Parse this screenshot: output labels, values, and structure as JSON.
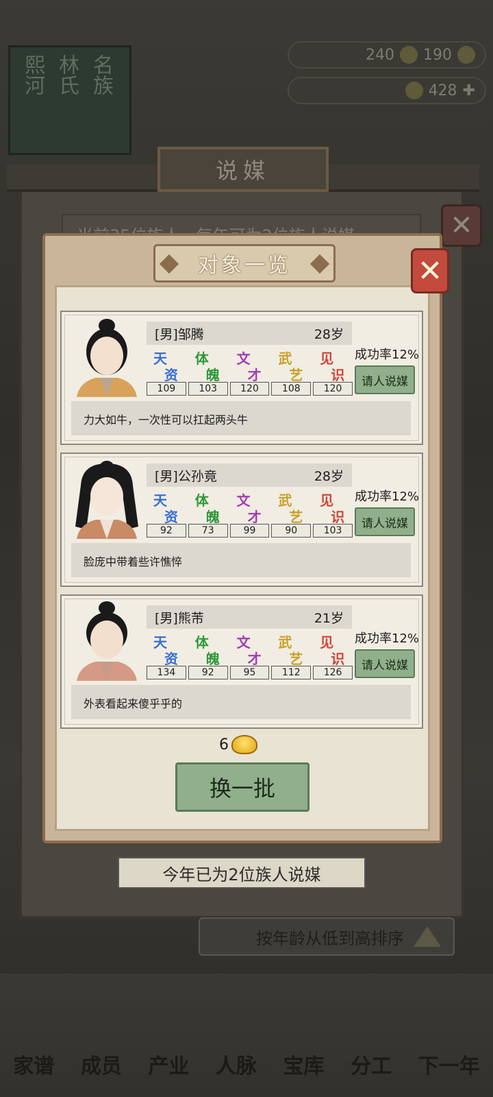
{
  "background": {
    "clan_banner": [
      "熙河",
      "林氏",
      "名族"
    ],
    "currencies": [
      {
        "value": "240",
        "icon": "ticket-icon"
      },
      {
        "value": "190",
        "icon": "coin-icon"
      },
      {
        "value": "428",
        "icon": "gold-ingot-icon"
      }
    ],
    "window_title": "说媒",
    "window_subtitle": "当前35位族人，每年可为2位族人说媒",
    "footer_label": "今年已为2位族人说媒",
    "sort_label": "按年龄从低到高排序",
    "nav_items": [
      "家谱",
      "成员",
      "产业",
      "人脉",
      "宝库",
      "分工",
      "下一年"
    ]
  },
  "dialog": {
    "title": "对象一览",
    "stat_glyphs": [
      {
        "top": "天",
        "bottom": "资",
        "color": "#3a6fd0"
      },
      {
        "top": "体",
        "bottom": "魄",
        "color": "#2f9a3a"
      },
      {
        "top": "文",
        "bottom": "才",
        "color": "#a33bb5"
      },
      {
        "top": "武",
        "bottom": "艺",
        "color": "#c9a02a"
      },
      {
        "top": "见",
        "bottom": "识",
        "color": "#d0463a"
      }
    ],
    "candidates": [
      {
        "name": "[男]邹腾",
        "age": "28岁",
        "stats": [
          "109",
          "103",
          "120",
          "108",
          "120"
        ],
        "success_rate": "成功率12%",
        "button": "请人说媒",
        "description": "力大如牛，一次性可以扛起两头牛"
      },
      {
        "name": "[男]公孙竟",
        "age": "28岁",
        "stats": [
          "92",
          "73",
          "99",
          "90",
          "103"
        ],
        "success_rate": "成功率12%",
        "button": "请人说媒",
        "description": "脸庞中带着些许憔悴"
      },
      {
        "name": "[男]熊芾",
        "age": "21岁",
        "stats": [
          "134",
          "92",
          "95",
          "112",
          "126"
        ],
        "success_rate": "成功率12%",
        "button": "请人说媒",
        "description": "外表看起来傻乎乎的"
      }
    ],
    "refresh_cost": "6",
    "refresh_label": "换一批"
  }
}
